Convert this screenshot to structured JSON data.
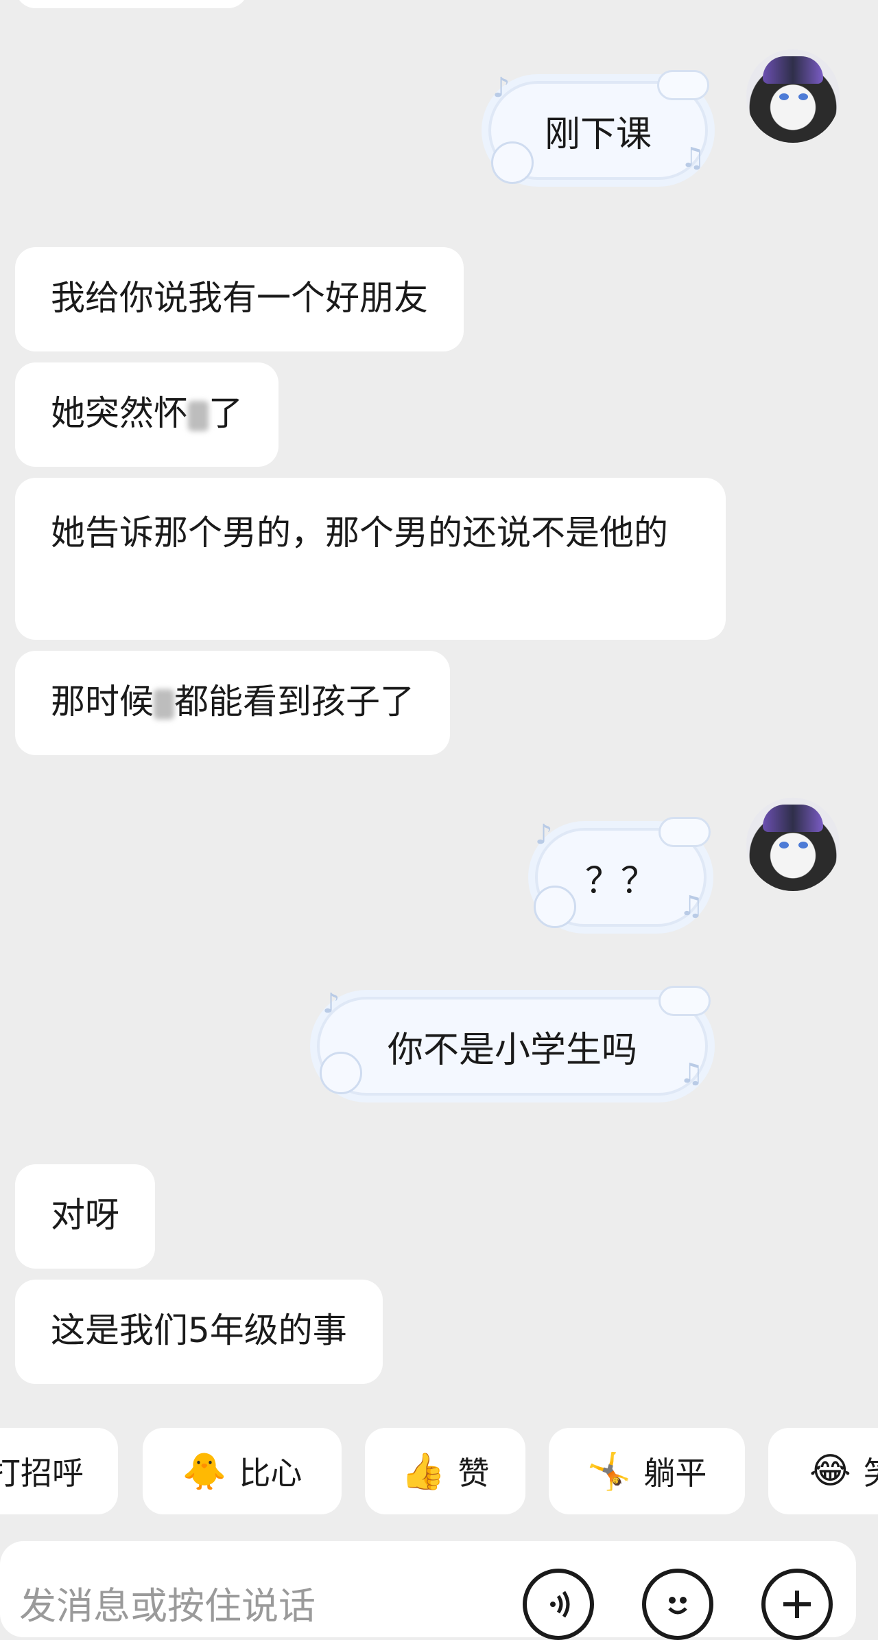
{
  "messages": [
    {
      "side": "right",
      "text": "刚下课"
    },
    {
      "side": "left",
      "text": "我给你说我有一个好朋友"
    },
    {
      "side": "left",
      "text_a": "她突然怀",
      "text_b": "了"
    },
    {
      "side": "left",
      "text": "她告诉那个男的，那个男的还说不是他的"
    },
    {
      "side": "left",
      "text_a": "那时候",
      "text_b": "都能看到孩子了"
    },
    {
      "side": "right",
      "text": "？？"
    },
    {
      "side": "right",
      "text": "你不是小学生吗"
    },
    {
      "side": "left",
      "text": "对呀"
    },
    {
      "side": "left",
      "text": "这是我们5年级的事"
    }
  ],
  "quick_replies": [
    {
      "label": "打招呼",
      "icon": "wave-icon"
    },
    {
      "label": "比心",
      "icon": "heart-hands-emoji"
    },
    {
      "label": "赞",
      "icon": "thumbs-up-emoji"
    },
    {
      "label": "躺平",
      "icon": "lying-flat-emoji"
    },
    {
      "label": "笑",
      "icon": "laughing-emoji"
    }
  ],
  "input": {
    "placeholder": "发消息或按住说话"
  },
  "toolbar": {
    "voice_icon": "voice-icon",
    "emoji_icon": "emoji-face-icon",
    "plus_icon": "plus-icon"
  }
}
